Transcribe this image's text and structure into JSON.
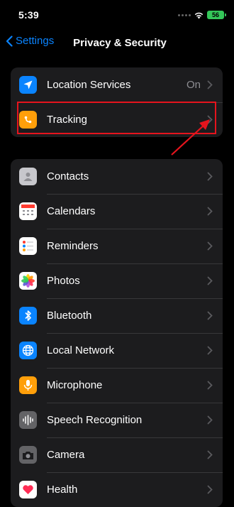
{
  "status_bar": {
    "time": "5:39",
    "battery": "56"
  },
  "nav": {
    "back_label": "Settings",
    "title": "Privacy & Security"
  },
  "groups": [
    {
      "rows": [
        {
          "label": "Location Services",
          "value": "On",
          "icon": "location-arrow-icon",
          "icon_color": "#0a84ff"
        },
        {
          "label": "Tracking",
          "value": "",
          "icon": "tracking-icon",
          "icon_color": "#ff9f0a"
        }
      ]
    },
    {
      "rows": [
        {
          "label": "Contacts",
          "icon": "contacts-icon",
          "icon_color": "#c7c7cc"
        },
        {
          "label": "Calendars",
          "icon": "calendar-icon",
          "icon_color": "#ffffff"
        },
        {
          "label": "Reminders",
          "icon": "reminders-icon",
          "icon_color": "#ffffff"
        },
        {
          "label": "Photos",
          "icon": "photos-icon",
          "icon_color": "#ffffff"
        },
        {
          "label": "Bluetooth",
          "icon": "bluetooth-icon",
          "icon_color": "#0a84ff"
        },
        {
          "label": "Local Network",
          "icon": "globe-icon",
          "icon_color": "#0a84ff"
        },
        {
          "label": "Microphone",
          "icon": "microphone-icon",
          "icon_color": "#ff9f0a"
        },
        {
          "label": "Speech Recognition",
          "icon": "waveform-icon",
          "icon_color": "#636366"
        },
        {
          "label": "Camera",
          "icon": "camera-icon",
          "icon_color": "#636366"
        },
        {
          "label": "Health",
          "icon": "heart-icon",
          "icon_color": "#ffffff"
        }
      ]
    }
  ],
  "annotation": {
    "highlight_color": "#e5141d"
  }
}
